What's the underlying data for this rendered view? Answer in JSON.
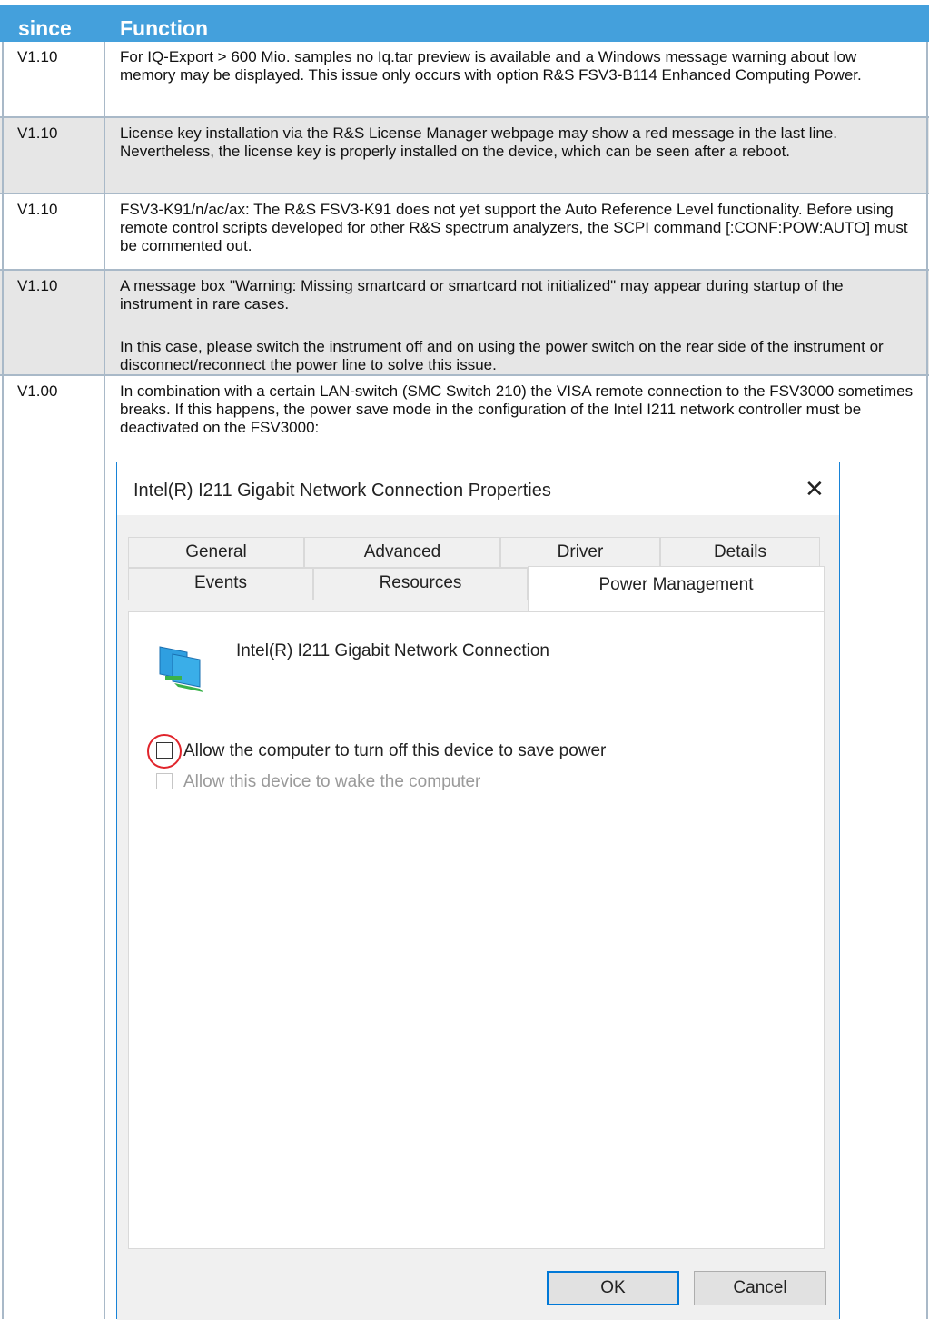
{
  "header": {
    "col_since": "since",
    "col_function": "Function"
  },
  "rows": [
    {
      "since": "V1.10",
      "text": "For IQ-Export > 600 Mio. samples no Iq.tar preview is available and a Windows message warning about low memory may be displayed. This issue only occurs with option R&S FSV3-B114 Enhanced Computing Power."
    },
    {
      "since": "V1.10",
      "text": "License key installation via the R&S License Manager webpage may show a red message in the last line. Nevertheless, the license key is properly installed on the device, which can be seen after a reboot."
    },
    {
      "since": "V1.10",
      "text": "FSV3-K91/n/ac/ax: The R&S FSV3-K91 does not yet support the Auto Reference Level functionality. Before using remote control scripts developed for other R&S spectrum analyzers, the SCPI command [:CONF:POW:AUTO] must be commented out."
    },
    {
      "since": "V1.10",
      "text": "A message box \"Warning: Missing smartcard or smartcard not initialized\" may appear during startup of the instrument in rare cases.",
      "text2": "In this case, please switch the instrument off and on using the power switch on the rear side of the instrument or disconnect/reconnect the power line to solve this issue."
    },
    {
      "since": "V1.00",
      "text": "In combination with a certain LAN-switch (SMC Switch 210) the VISA remote connection to the FSV3000 sometimes breaks. If this happens, the power save mode in the configuration of the Intel I211 network controller must be deactivated on the FSV3000:"
    }
  ],
  "dialog": {
    "title": "Intel(R) I211 Gigabit Network Connection Properties",
    "close_glyph": "✕",
    "tabs_row1": [
      "General",
      "Advanced",
      "Driver",
      "Details"
    ],
    "tabs_row2": [
      "Events",
      "Resources",
      "Power Management"
    ],
    "active_tab": "Power Management",
    "device_name": "Intel(R) I211 Gigabit Network Connection",
    "device_icon": "network-adapter-icon",
    "option_power_save": {
      "label": "Allow the computer to turn off this device to save power",
      "checked": false,
      "highlighted": true
    },
    "option_wake": {
      "label": "Allow this device to wake the computer",
      "checked": false,
      "disabled": true
    },
    "ok_label": "OK",
    "cancel_label": "Cancel"
  },
  "colors": {
    "header_bg": "#44a0dc",
    "row_shade": "#e6e6e6",
    "grid": "#a9b9c8",
    "highlight_ring": "#e0242b",
    "dialog_accent": "#0078d7"
  }
}
